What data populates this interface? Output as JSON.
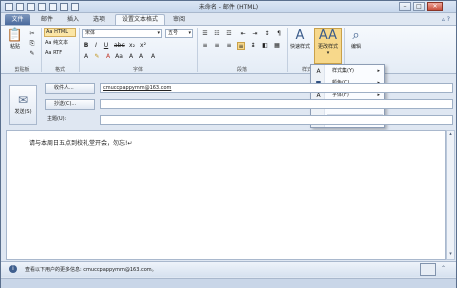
{
  "window": {
    "title": "未命名 - 邮件 (HTML)",
    "controls": {
      "minimize": "–",
      "maximize": "□",
      "close": "✕"
    }
  },
  "tabs": {
    "file": "文件",
    "items": [
      {
        "label": "邮件"
      },
      {
        "label": "插入"
      },
      {
        "label": "选项"
      },
      {
        "label": "设置文本格式"
      },
      {
        "label": "审阅"
      }
    ]
  },
  "ribbon": {
    "clipboard": {
      "paste": "粘贴",
      "group": "剪贴板"
    },
    "format": {
      "html": "Aa HTML",
      "plain": "Aa 纯文本",
      "rtf": "Aa RTF",
      "group": "格式"
    },
    "font": {
      "family": "宋体",
      "size": "五号",
      "group": "字体"
    },
    "paragraph": {
      "group": "段落"
    },
    "styles": {
      "quick": "快速样式",
      "change": "更改样式",
      "group": "样式"
    },
    "editing": {
      "label": "编辑"
    }
  },
  "menu": {
    "items": [
      {
        "label": "样式集(Y)",
        "icon": "A",
        "arrow": "▸"
      },
      {
        "label": "颜色(C)",
        "icon": "■",
        "arrow": "▸"
      },
      {
        "label": "字体(F)",
        "icon": "A",
        "arrow": "▸"
      },
      {
        "label": "段落间距(P)",
        "icon": "≡",
        "arrow": "▸"
      },
      {
        "label": "设为默认值(S)",
        "icon": "",
        "arrow": ""
      }
    ]
  },
  "compose": {
    "send": "发送(S)",
    "to_button": "收件人...",
    "to_value": "cmuccpappymm@163.com",
    "cc_button": "抄送(C)...",
    "cc_value": "",
    "subject_label": "主题(U):",
    "subject_value": ""
  },
  "body": {
    "text": "请与本周日五点到校礼堂开会，勿忘!↵"
  },
  "people_pane": {
    "text": "查看以下用户的更多信息: cmuccpappymm@163.com。"
  }
}
